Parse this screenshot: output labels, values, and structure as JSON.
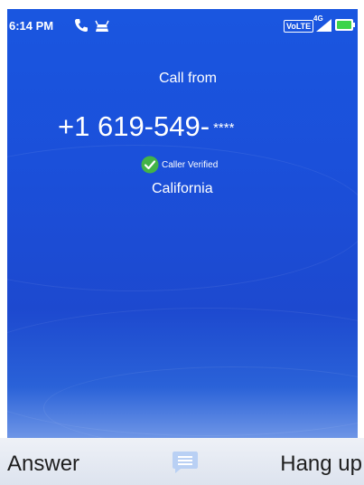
{
  "status_bar": {
    "time": "6:14 PM",
    "volte_label": "VoLTE",
    "network_label": "4G",
    "icons": [
      "phone-call-icon",
      "android-debug-icon",
      "volte-icon",
      "signal-icon",
      "battery-icon"
    ]
  },
  "call": {
    "header": "Call from",
    "number": "+1 619-549-",
    "number_masked": "****",
    "verified_label": "Caller Verified",
    "location": "California"
  },
  "softkeys": {
    "left_label": "Answer",
    "center_icon": "message-icon",
    "right_label": "Hang up"
  },
  "colors": {
    "background_top": "#1a56e0",
    "background_bottom": "#6e95e6",
    "verified_green": "#43b347",
    "softkey_bar": "#e4e8f1",
    "message_icon": "#b9d0f4",
    "battery_fill": "#3dd44a"
  }
}
